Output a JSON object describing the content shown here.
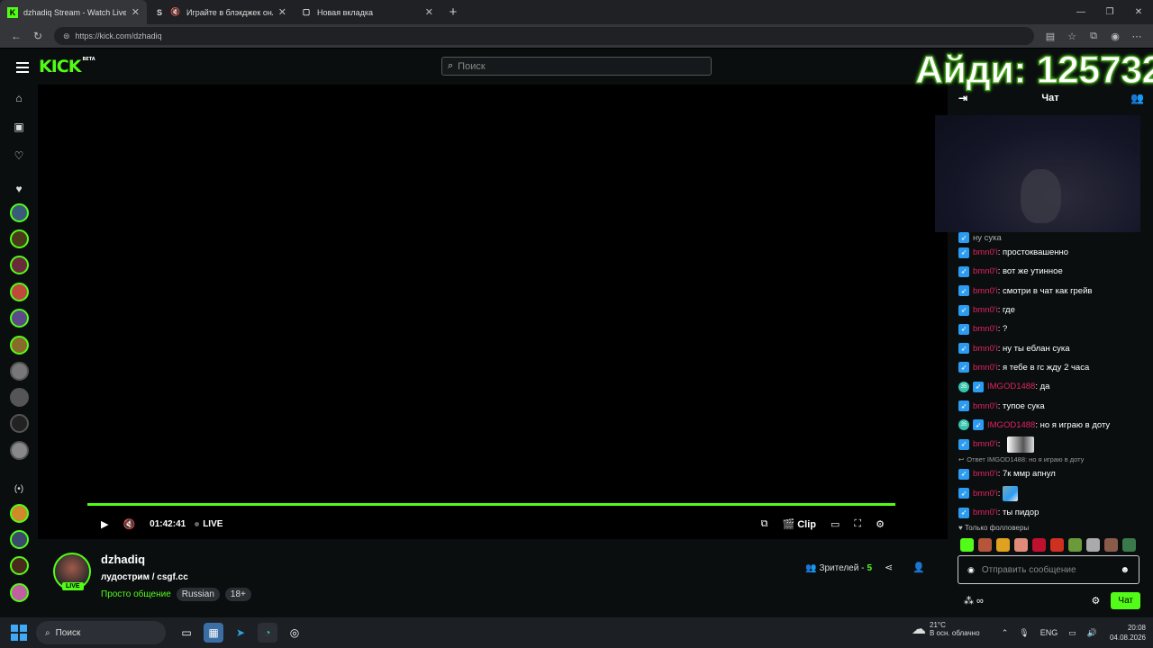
{
  "browser": {
    "tabs": [
      {
        "title": "dzhadiq Stream - Watch Live on Kick",
        "favicon": "K",
        "active": true
      },
      {
        "title": "Играйте в блэкджек онлайн",
        "favicon": "S",
        "active": false
      },
      {
        "title": "Новая вкладка",
        "favicon": "▢",
        "active": false
      }
    ],
    "new_tab_icon": "+",
    "url": "https://kick.com/dzhadiq"
  },
  "site": {
    "logo": "KICK",
    "logo_badge": "BETA",
    "search_placeholder": "Поиск"
  },
  "overlay": {
    "id_text": "Айди: 125732"
  },
  "player": {
    "time": "01:42:41",
    "live_label": "LIVE",
    "clip_label": "Clip"
  },
  "stream": {
    "channel_name": "dzhadiq",
    "live_badge": "LIVE",
    "title": "лудострим / csgf.cc",
    "category": "Просто общение",
    "tags": [
      "Russian",
      "18+"
    ],
    "viewers_label": "Зрителей -",
    "viewers_count": "5"
  },
  "chat": {
    "header": "Чат",
    "partial_line": "ну сука",
    "messages": [
      {
        "user": "bmn0'i",
        "text": ": простоквашенно",
        "sub": false
      },
      {
        "user": "bmn0'i",
        "text": ": вот же утинное",
        "sub": false
      },
      {
        "user": "bmn0'i",
        "text": ": смотри в чат как грейв",
        "sub": false
      },
      {
        "user": "bmn0'i",
        "text": ": где",
        "sub": false
      },
      {
        "user": "bmn0'i",
        "text": ": ?",
        "sub": false
      },
      {
        "user": "bmn0'i",
        "text": ": ну ты еблан сука",
        "sub": false
      },
      {
        "user": "bmn0'i",
        "text": ": я тебе в гс жду 2 часа",
        "sub": false
      },
      {
        "user": "IMGOD1488",
        "text": ": да",
        "sub": true
      },
      {
        "user": "bmn0'i",
        "text": ": тупое сука",
        "sub": false
      },
      {
        "user": "IMGOD1488",
        "text": ": но я играю в доту",
        "sub": true
      }
    ],
    "emote_message_user": "bmn0'i",
    "reply_text": "Ответ IMGOD1488: но я играю в доту",
    "reply_message": {
      "user": "bmn0'i",
      "text": ": 7к ммр апнул"
    },
    "emote_message2_user": "bmn0'i",
    "last_message": {
      "user": "bmn0'i",
      "text": ": ты пидор"
    },
    "followers_only": "Только фолловеры",
    "input_placeholder": "Отправить сообщение",
    "send_label": "Чат"
  },
  "taskbar": {
    "search_label": "Поиск",
    "temperature": "21°C",
    "weather_text": "В осн. облачно",
    "language": "ENG",
    "time": "20:08",
    "date": "04.08.2026"
  }
}
